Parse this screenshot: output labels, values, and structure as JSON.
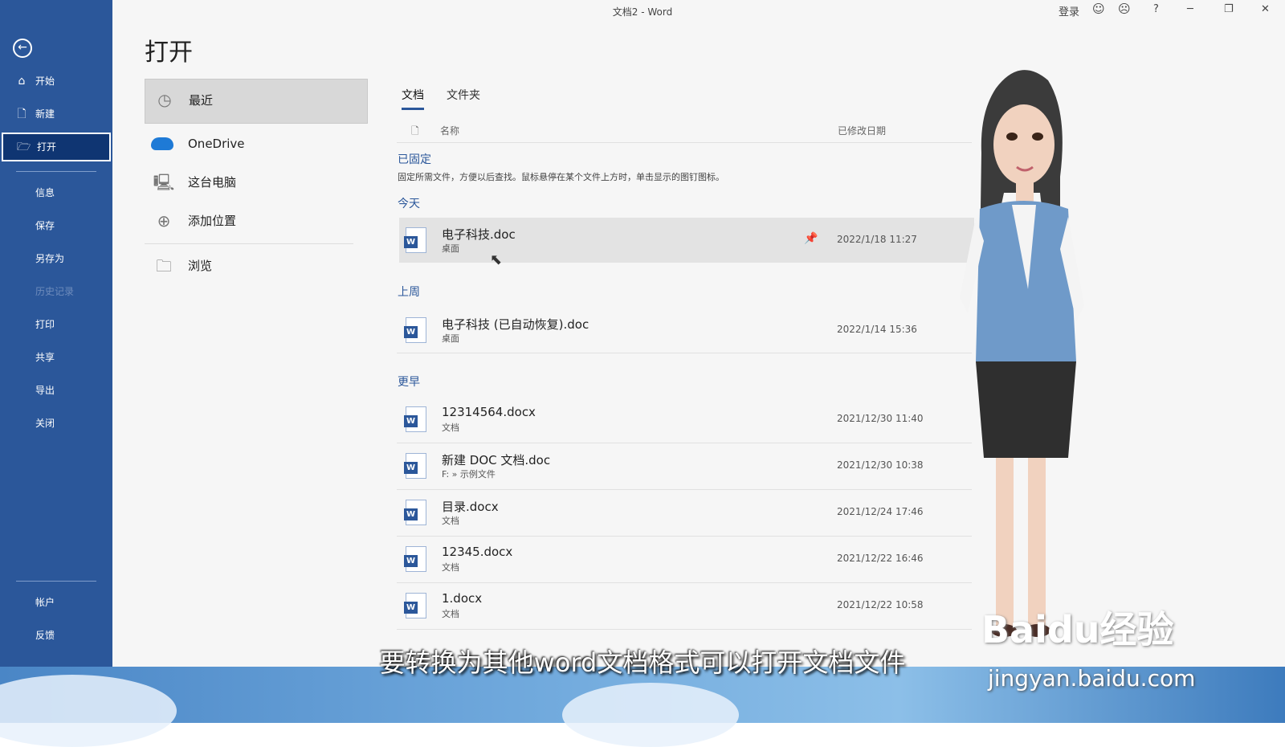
{
  "window": {
    "title": "文档2  -  Word",
    "login": "登录",
    "help": "?",
    "minimize": "─",
    "restore": "❐",
    "close": "✕"
  },
  "sidebar": {
    "back_icon": "back-arrow-icon",
    "items": [
      {
        "label": "开始",
        "icon": "⌂"
      },
      {
        "label": "新建",
        "icon": "🗋"
      },
      {
        "label": "打开",
        "icon": "🗁"
      },
      {
        "label": "信息"
      },
      {
        "label": "保存"
      },
      {
        "label": "另存为"
      },
      {
        "label": "历史记录"
      },
      {
        "label": "打印"
      },
      {
        "label": "共享"
      },
      {
        "label": "导出"
      },
      {
        "label": "关闭"
      }
    ],
    "bottom_items": [
      {
        "label": "帐户"
      },
      {
        "label": "反馈"
      }
    ]
  },
  "page_title": "打开",
  "locations": [
    {
      "label": "最近",
      "icon": "clock-icon"
    },
    {
      "label": "OneDrive",
      "icon": "cloud-icon"
    },
    {
      "label": "这台电脑",
      "icon": "computer-icon"
    },
    {
      "label": "添加位置",
      "icon": "globe-plus-icon"
    },
    {
      "label": "浏览",
      "icon": "folder-icon"
    }
  ],
  "tabs": [
    "文档",
    "文件夹"
  ],
  "columns": {
    "name": "名称",
    "modified": "已修改日期"
  },
  "groups": {
    "pinned": "已固定",
    "pinned_note": "固定所需文件，方便以后查找。鼠标悬停在某个文件上方时，单击显示的图钉图标。",
    "today": "今天",
    "last_week": "上周",
    "earlier": "更早"
  },
  "files": [
    {
      "name": "电子科技.doc",
      "location": "桌面",
      "date": "2022/1/18 11:27"
    },
    {
      "name": "电子科技 (已自动恢复).doc",
      "location": "桌面",
      "date": "2022/1/14 15:36"
    },
    {
      "name": "12314564.docx",
      "location": "文档",
      "date": "2021/12/30 11:40"
    },
    {
      "name": "新建 DOC 文档.doc",
      "location": "F: » 示例文件",
      "date": "2021/12/30 10:38"
    },
    {
      "name": "目录.docx",
      "location": "文档",
      "date": "2021/12/24 17:46"
    },
    {
      "name": "12345.docx",
      "location": "文档",
      "date": "2021/12/22 16:46"
    },
    {
      "name": "1.docx",
      "location": "文档",
      "date": "2021/12/22 10:58"
    }
  ],
  "overlay": {
    "subtitle": "要转换为其他word文档格式可以打开文档文件",
    "watermark": "Baidu经验",
    "watermark_url": "jingyan.baidu.com"
  },
  "colors": {
    "accent": "#2b579a",
    "sidebar_selected": "#0f3572"
  }
}
